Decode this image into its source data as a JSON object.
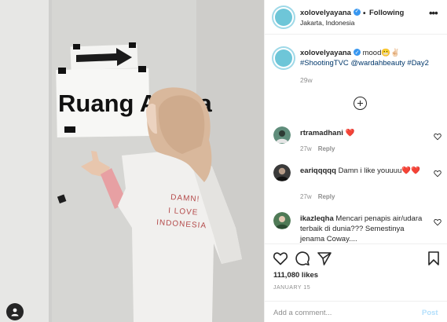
{
  "photo": {
    "sign_text": "Ruang Ayana",
    "shirt_lines": [
      "DAMN!",
      "I LOVE",
      "INDONESIA"
    ]
  },
  "header": {
    "username": "xolovelyayana",
    "separator": "•",
    "follow_label": "Following",
    "location": "Jakarta, Indonesia",
    "more_label": "•••"
  },
  "caption": {
    "username": "xolovelyayana",
    "text": "mood",
    "emoji": "😬✌🏻",
    "hashtags": [
      "#ShootingTVC",
      "@wardahbeauty",
      "#Day2"
    ],
    "time": "29w"
  },
  "comments": [
    {
      "username": "rtramadhani",
      "text": "❤️",
      "time": "27w",
      "reply": "Reply",
      "avatar_color": "#4a7f6a"
    },
    {
      "username": "eariqqqqq",
      "text": "Damn i like youuuu❤️❤️",
      "time": "27w",
      "reply": "Reply",
      "avatar_color": "#2b2b2b"
    },
    {
      "username": "ikazleqha",
      "text": "Mencari penapis air/udara terbaik di dunia??? Semestinya jenama Coway....",
      "time": "",
      "reply": "",
      "avatar_color": "#3d6b4a"
    }
  ],
  "actions": {
    "likes": "111,080 likes",
    "date": "JANUARY 15",
    "comment_placeholder": "Add a comment...",
    "post_label": "Post"
  },
  "colors": {
    "link": "#00376b",
    "verified": "#3897f0",
    "muted": "#8e8e8e",
    "post_disabled": "#b2dffc",
    "story_ring": "#9fd9e8"
  }
}
